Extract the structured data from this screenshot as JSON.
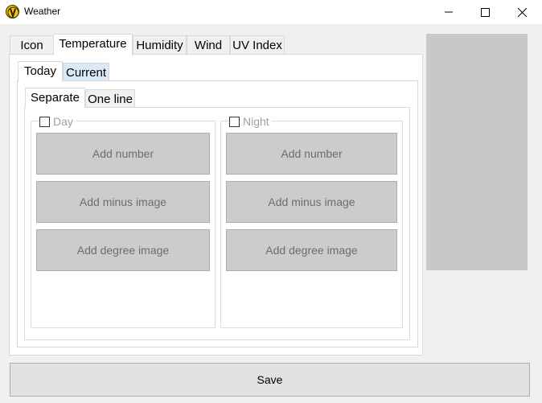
{
  "window": {
    "title": "Weather",
    "controls": {
      "minimize": "minimize-icon",
      "maximize": "maximize-icon",
      "close": "close-icon"
    }
  },
  "main_tabs": [
    {
      "label": "Icon",
      "active": false
    },
    {
      "label": "Temperature",
      "active": true
    },
    {
      "label": "Humidity",
      "active": false
    },
    {
      "label": "Wind",
      "active": false
    },
    {
      "label": "UV Index",
      "active": false
    }
  ],
  "sub_tabs": [
    {
      "label": "Today",
      "active": true
    },
    {
      "label": "Current",
      "active": false
    }
  ],
  "mode_tabs": [
    {
      "label": "Separate",
      "active": true
    },
    {
      "label": "One line",
      "active": false
    }
  ],
  "day_group": {
    "label": "Day",
    "checked": false,
    "buttons": [
      "Add number",
      "Add minus image",
      "Add degree image"
    ]
  },
  "night_group": {
    "label": "Night",
    "checked": false,
    "buttons": [
      "Add number",
      "Add minus image",
      "Add degree image"
    ]
  },
  "save_label": "Save",
  "colors": {
    "background": "#f0f0f0",
    "button_bg": "#cccccc",
    "button_text": "#6d6d6d",
    "preview_bg": "#c8c8c8",
    "hover_tab": "#dbe8f6"
  }
}
